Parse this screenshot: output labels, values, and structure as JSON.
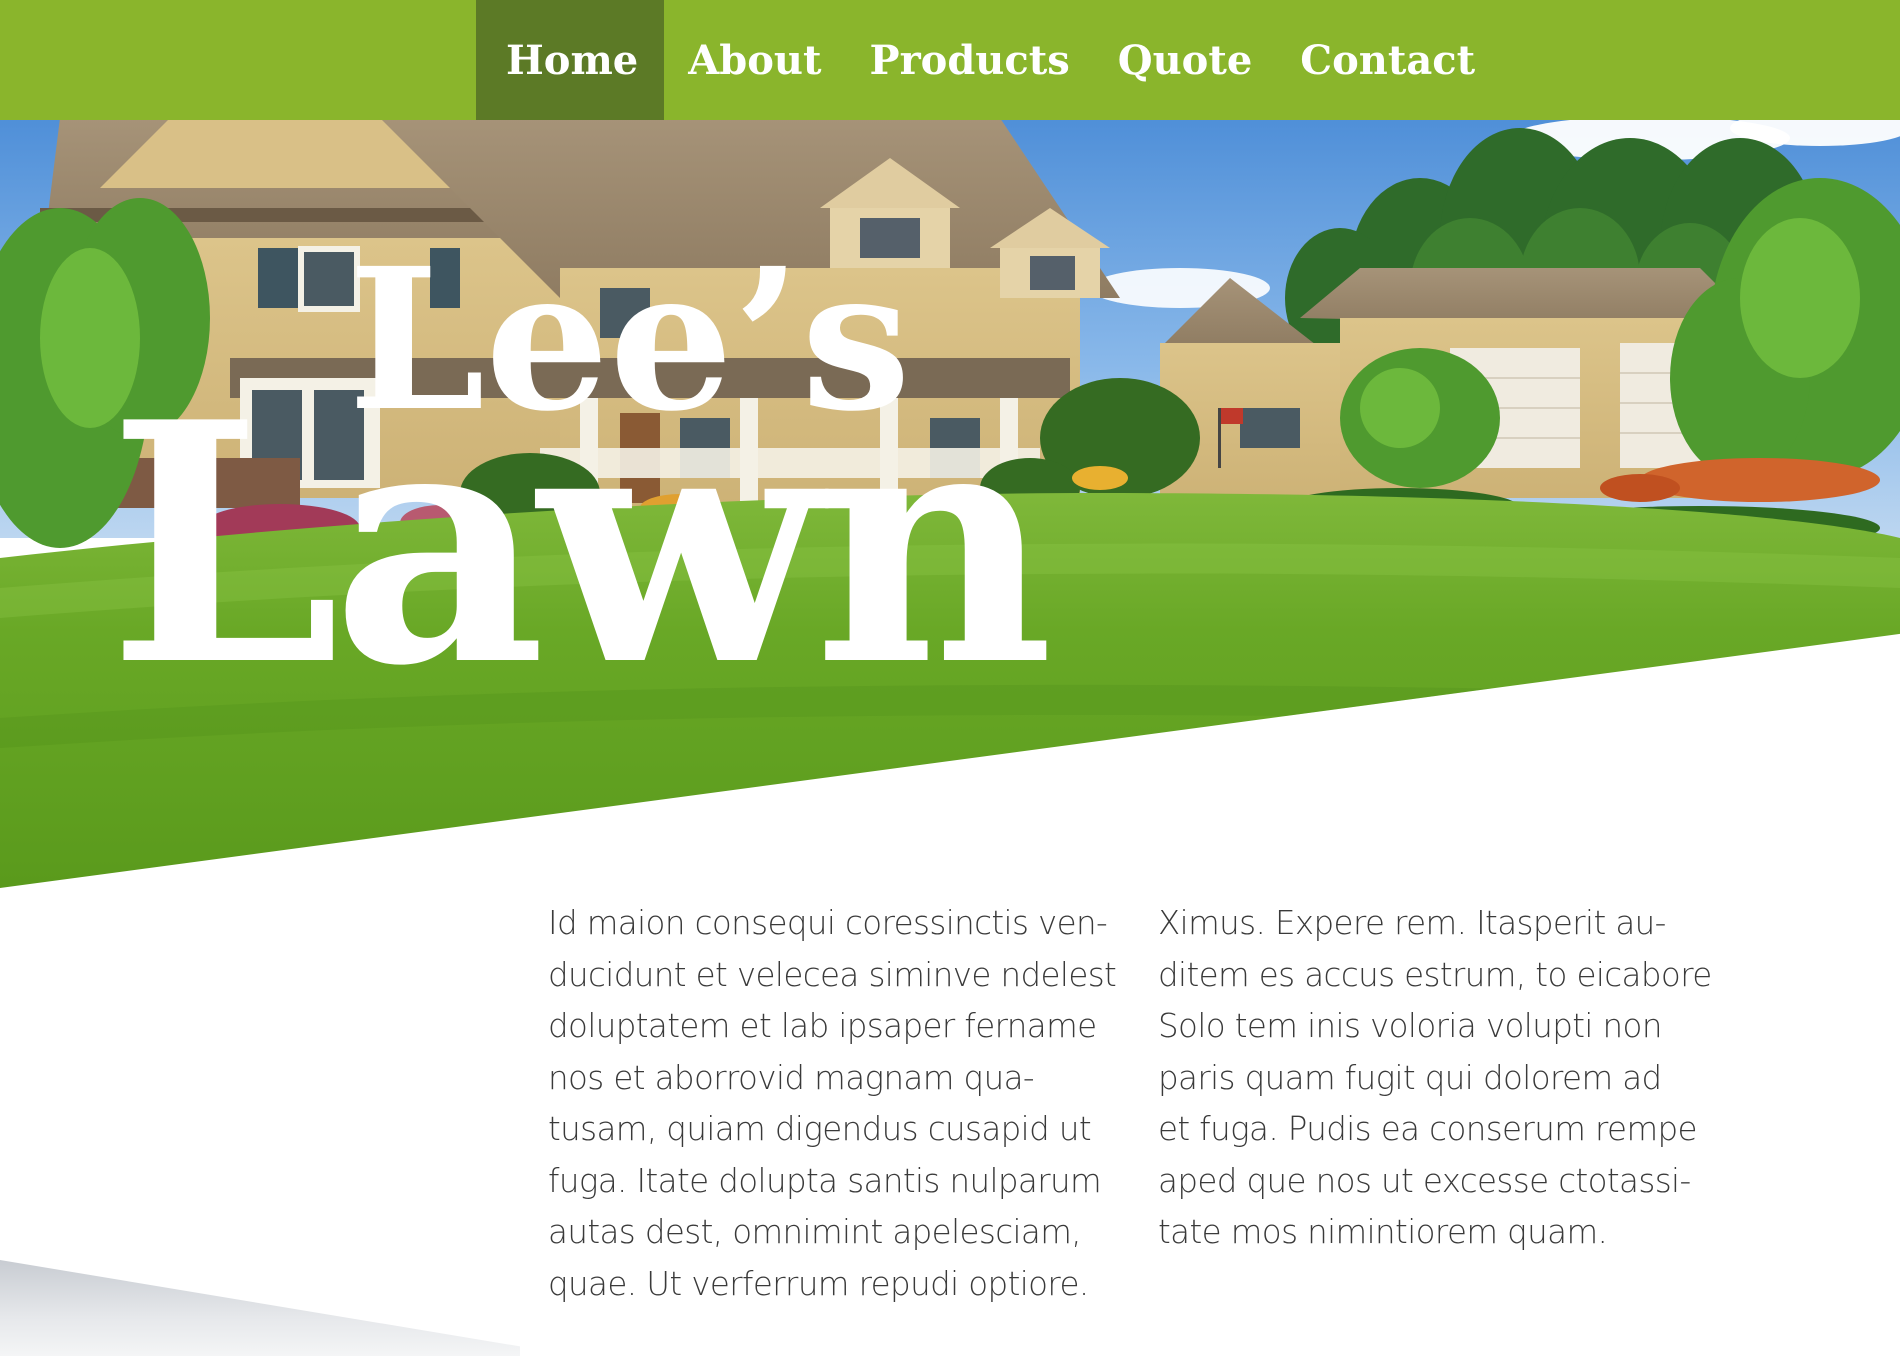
{
  "nav": {
    "items": [
      {
        "label": "Home",
        "active": true
      },
      {
        "label": "About",
        "active": false
      },
      {
        "label": "Products",
        "active": false
      },
      {
        "label": "Quote",
        "active": false
      },
      {
        "label": "Contact",
        "active": false
      }
    ]
  },
  "hero": {
    "logo_line1": "Lee’s",
    "logo_line2": "Lawn",
    "image": "house-lawn-photo"
  },
  "content": {
    "column1": "Id maion consequi coressinctis ven-\nducidunt et velecea siminve ndelest\ndoluptatem et lab ipsaper fername\nnos et aborrovid magnam qua-\ntusam, quiam digendus cusapid ut\nfuga. Itate dolupta santis nulparum\nautas dest, omnimint apelesciam,\nquae. Ut verferrum repudi optiore.",
    "column2": "Ximus. Expere rem. Itasperit au-\nditem es accus estrum, to eicabore\nSolo tem inis voloria volupti non\nparis quam fugit qui dolorem ad\net fuga. Pudis ea conserum rempe\naped que nos ut excesse ctotassi-\ntate mos nimintiorem quam."
  },
  "colors": {
    "nav_bg": "#8ab52c",
    "nav_active": "#5c7a26",
    "text": "#3a3a3a"
  }
}
